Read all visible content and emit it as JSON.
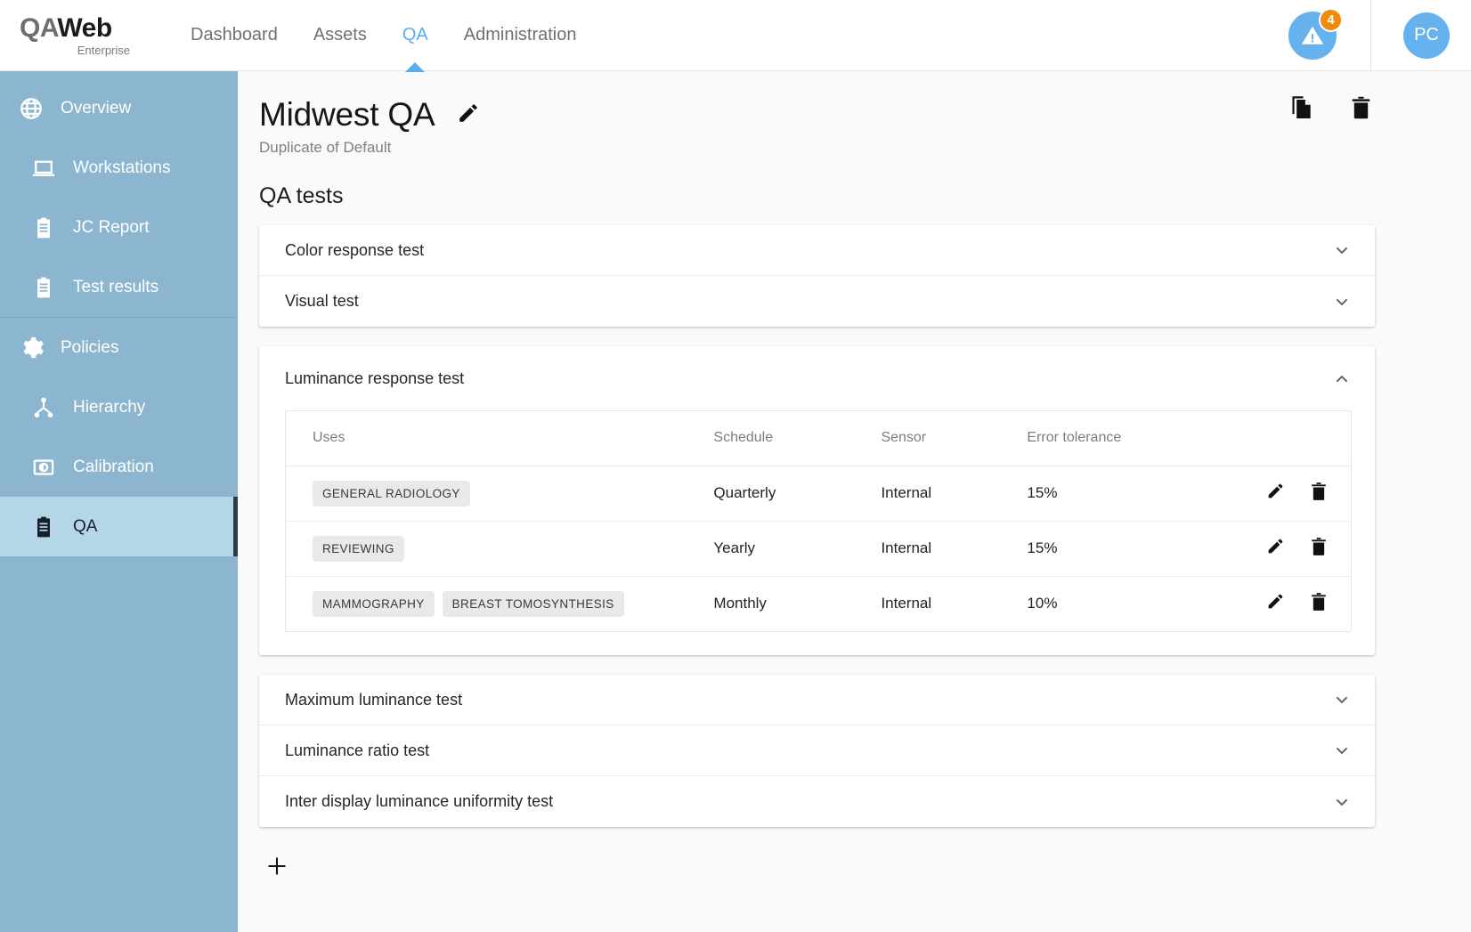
{
  "app": {
    "logo_qa": "QA",
    "logo_web": "Web",
    "logo_sub": "Enterprise"
  },
  "topnav": {
    "items": [
      {
        "label": "Dashboard",
        "active": false
      },
      {
        "label": "Assets",
        "active": false
      },
      {
        "label": "QA",
        "active": true
      },
      {
        "label": "Administration",
        "active": false
      }
    ],
    "alert_badge_count": "4",
    "alert_icon": "warning-triangle-icon",
    "avatar_initials": "PC"
  },
  "sidebar": {
    "items": [
      {
        "label": "Overview",
        "icon": "globe-icon",
        "level": 0,
        "active": false
      },
      {
        "label": "Workstations",
        "icon": "laptop-icon",
        "level": 1,
        "active": false
      },
      {
        "label": "JC Report",
        "icon": "clipboard-icon",
        "level": 1,
        "active": false
      },
      {
        "label": "Test results",
        "icon": "clipboard-icon",
        "level": 1,
        "active": false
      },
      {
        "label": "Policies",
        "icon": "gear-icon",
        "level": 0,
        "active": false
      },
      {
        "label": "Hierarchy",
        "icon": "hierarchy-icon",
        "level": 1,
        "active": false
      },
      {
        "label": "Calibration",
        "icon": "calibration-icon",
        "level": 1,
        "active": false
      },
      {
        "label": "QA",
        "icon": "clipboard-icon",
        "level": 1,
        "active": true
      }
    ]
  },
  "page": {
    "title": "Midwest QA",
    "subtitle": "Duplicate of Default",
    "edit_icon": "pencil-icon",
    "actions": [
      {
        "name": "duplicate-button",
        "icon": "copy-icon"
      },
      {
        "name": "delete-button",
        "icon": "trash-icon"
      }
    ],
    "section_title": "QA tests",
    "add_button_icon": "plus-icon"
  },
  "tests": {
    "group_top": [
      {
        "label": "Color response test",
        "expanded": false,
        "chevron": "chevron-down-icon"
      },
      {
        "label": "Visual test",
        "expanded": false,
        "chevron": "chevron-down-icon"
      }
    ],
    "expanded_test": {
      "label": "Luminance response test",
      "expanded": true,
      "chevron": "chevron-up-icon",
      "columns": [
        "Uses",
        "Schedule",
        "Sensor",
        "Error tolerance"
      ],
      "rows": [
        {
          "uses": [
            "GENERAL RADIOLOGY"
          ],
          "schedule": "Quarterly",
          "sensor": "Internal",
          "tolerance": "15%",
          "edit_icon": "pencil-icon",
          "delete_icon": "trash-icon"
        },
        {
          "uses": [
            "REVIEWING"
          ],
          "schedule": "Yearly",
          "sensor": "Internal",
          "tolerance": "15%",
          "edit_icon": "pencil-icon",
          "delete_icon": "trash-icon"
        },
        {
          "uses": [
            "MAMMOGRAPHY",
            "BREAST TOMOSYNTHESIS"
          ],
          "schedule": "Monthly",
          "sensor": "Internal",
          "tolerance": "10%",
          "edit_icon": "pencil-icon",
          "delete_icon": "trash-icon"
        }
      ]
    },
    "group_bottom": [
      {
        "label": "Maximum luminance test",
        "expanded": false,
        "chevron": "chevron-down-icon"
      },
      {
        "label": "Luminance ratio test",
        "expanded": false,
        "chevron": "chevron-down-icon"
      },
      {
        "label": "Inter display luminance uniformity test",
        "expanded": false,
        "chevron": "chevron-down-icon"
      }
    ]
  },
  "colors": {
    "accent": "#5aaeee",
    "sidebar_bg": "#8cb6cf",
    "sidebar_active_bg": "#b5d5e8",
    "badge_orange": "#f18a09",
    "avatar_blue": "#66b2ef"
  }
}
